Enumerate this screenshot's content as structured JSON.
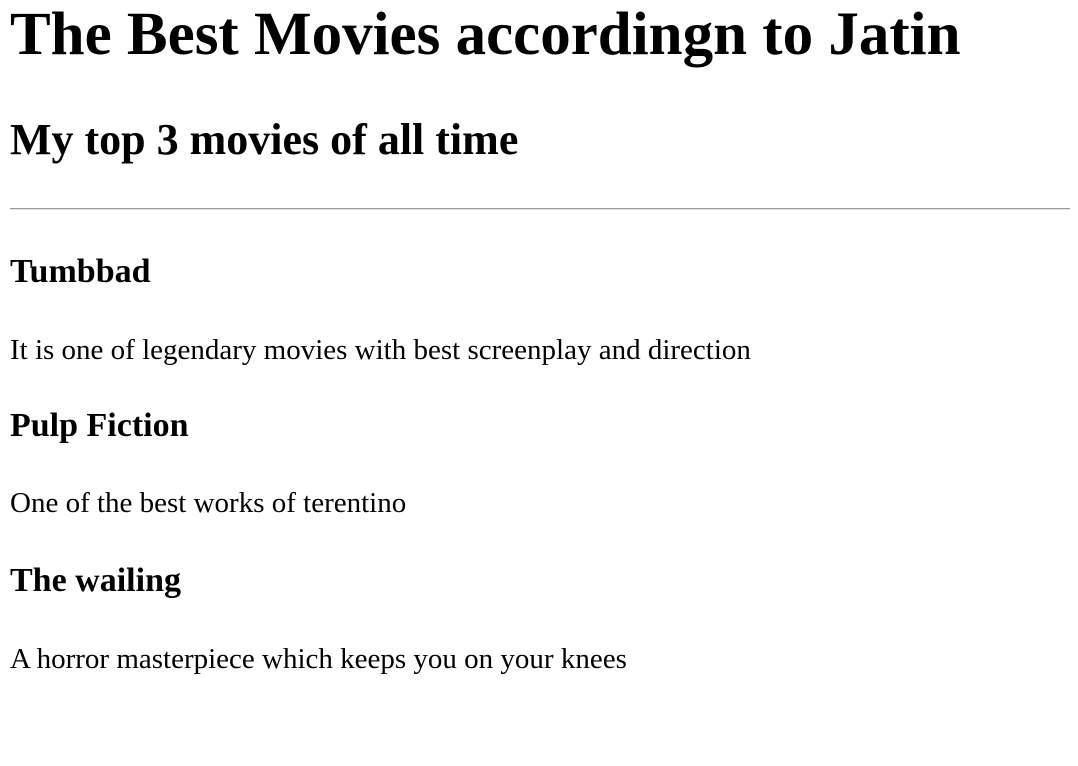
{
  "page": {
    "heading": "The Best Movies accordingn to Jatin",
    "subheading": "My top 3 movies of all time"
  },
  "movies": [
    {
      "title": "Tumbbad",
      "description": "It is one of legendary movies with best screenplay and direction"
    },
    {
      "title": "Pulp Fiction",
      "description": "One of the best works of terentino"
    },
    {
      "title": "The wailing",
      "description": "A horror masterpiece which keeps you on your knees"
    }
  ]
}
